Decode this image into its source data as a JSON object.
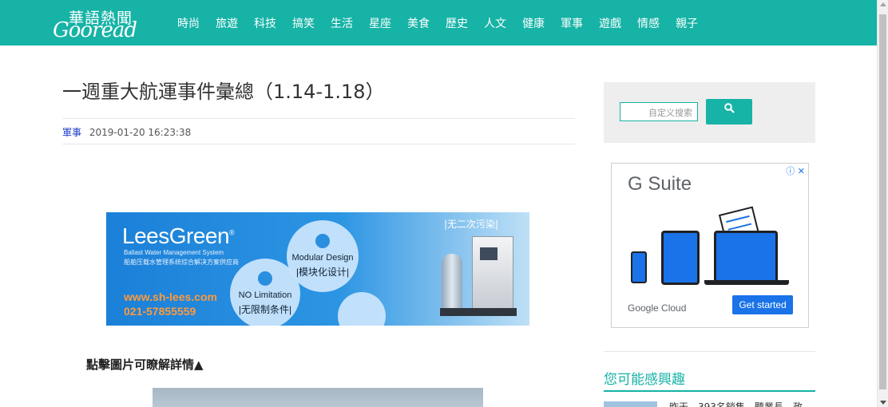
{
  "site": {
    "logo_cn": "華語熱聞",
    "logo_en": "Gooread"
  },
  "nav": [
    "時尚",
    "旅遊",
    "科技",
    "搞笑",
    "生活",
    "星座",
    "美食",
    "歷史",
    "人文",
    "健康",
    "軍事",
    "遊戲",
    "情感",
    "親子"
  ],
  "article": {
    "title": "一週重大航運事件彙總（1.14-1.18）",
    "category": "軍事",
    "timestamp": "2019-01-20 16:23:38",
    "caption": "點擊圖片可瞭解詳情▲"
  },
  "banner_ad": {
    "brand": "LeesGreen",
    "brand_mark": "®",
    "sub_en": "Ballast Water Management System",
    "sub_cn": "船舶压载水管理系统综合解决方案供应商",
    "website": "www.sh-lees.com",
    "phone": "021-57855559",
    "bubble1_en": "Modular Design",
    "bubble1_cn": "|模块化设计|",
    "bubble2_en": "NO Limitation",
    "bubble2_cn": "|无限制条件|",
    "badge": "|无二次污染|"
  },
  "search": {
    "placeholder": "自定义搜索",
    "button_icon": "search-icon"
  },
  "side_ad": {
    "title": "G Suite",
    "brand": "Google Cloud",
    "cta": "Get started",
    "choices": "ⓘ ✕"
  },
  "interest": {
    "title": "您可能感興趣",
    "item_text": "昨天，393名銷售，聽業長，政"
  },
  "colors": {
    "accent": "#16b3a6",
    "category_link": "#1a3cc8",
    "ad_blue": "#1a73e8"
  }
}
